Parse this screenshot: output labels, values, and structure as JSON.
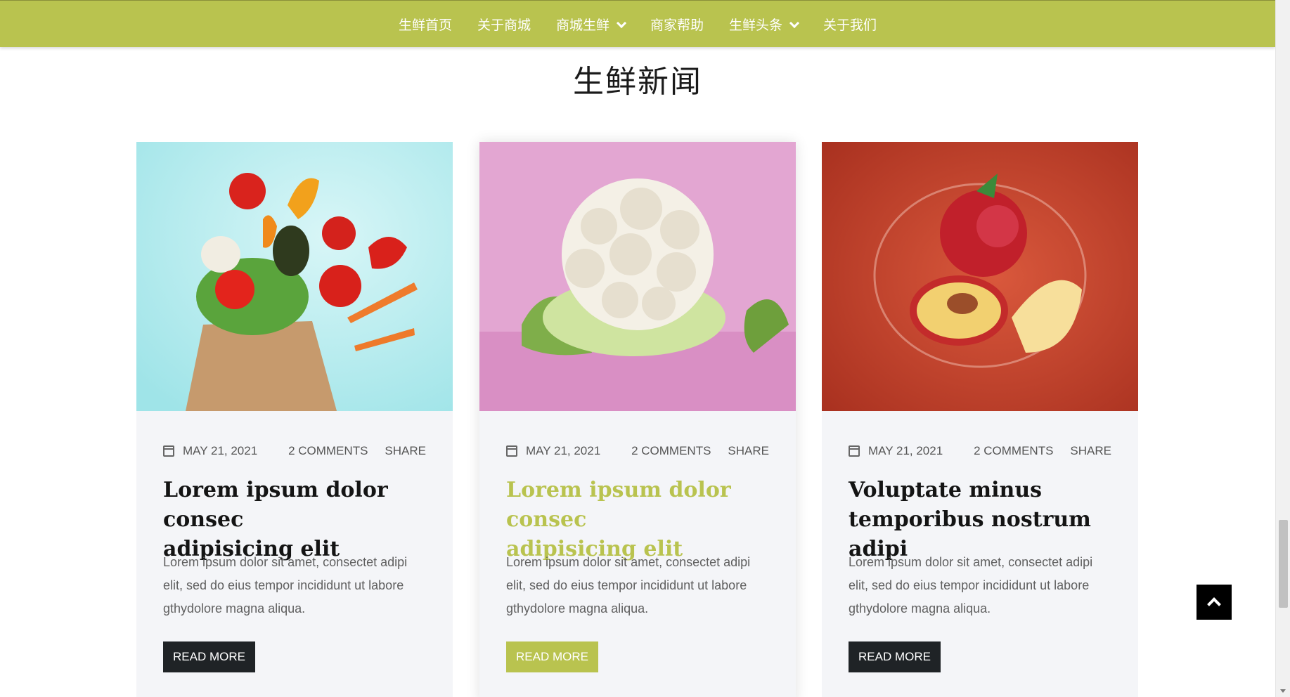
{
  "nav": {
    "items": [
      {
        "label": "生鲜首页",
        "dropdown": false
      },
      {
        "label": "关于商城",
        "dropdown": false
      },
      {
        "label": "商城生鲜",
        "dropdown": true
      },
      {
        "label": "商家帮助",
        "dropdown": false
      },
      {
        "label": "生鲜头条",
        "dropdown": true
      },
      {
        "label": "关于我们",
        "dropdown": false
      }
    ]
  },
  "section": {
    "title": "生鲜新闻"
  },
  "posts": [
    {
      "image": "vegetables-in-paper-bag",
      "date": "MAY 21, 2021",
      "comments": "2 COMMENTS",
      "share": "SHARE",
      "title_line1": "Lorem ipsum dolor consec",
      "title_line2": "adipisicing elit",
      "excerpt": "Lorem ipsum dolor sit amet, consectet adipi elit, sed do eius tempor incididunt ut labore gthydolore magna aliqua.",
      "button": "READ MORE"
    },
    {
      "image": "cauliflower",
      "date": "MAY 21, 2021",
      "comments": "2 COMMENTS",
      "share": "SHARE",
      "title_line1": "Lorem ipsum dolor consec",
      "title_line2": "adipisicing elit",
      "excerpt": "Lorem ipsum dolor sit amet, consectet adipi elit, sed do eius tempor incididunt ut labore gthydolore magna aliqua.",
      "button": "READ MORE"
    },
    {
      "image": "peach-water-splash",
      "date": "MAY 21, 2021",
      "comments": "2 COMMENTS",
      "share": "SHARE",
      "title_line1": "Voluptate minus",
      "title_line2": "temporibus nostrum adipi",
      "excerpt": "Lorem ipsum dolor sit amet, consectet adipi elit, sed do eius tempor incididunt ut labore gthydolore magna aliqua.",
      "button": "READ MORE"
    }
  ],
  "colors": {
    "accent": "#b9c34f",
    "dark": "#1f2326",
    "card_bg": "#f4f5f8"
  }
}
